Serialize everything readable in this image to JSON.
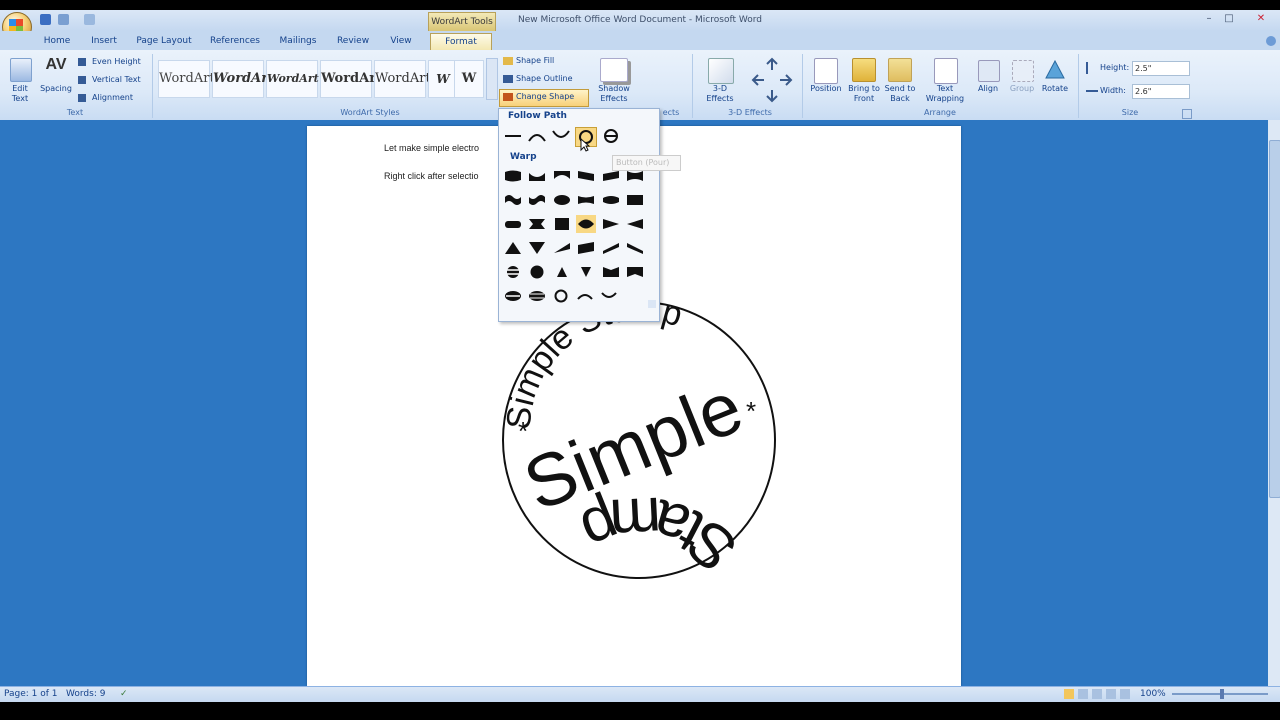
{
  "window": {
    "context_tab": "WordArt Tools",
    "title": "New Microsoft Office Word Document - Microsoft Word",
    "min_icon": "–",
    "max_icon": "□",
    "close_icon": "✕"
  },
  "tabs": [
    {
      "label": "Home"
    },
    {
      "label": "Insert"
    },
    {
      "label": "Page Layout"
    },
    {
      "label": "References"
    },
    {
      "label": "Mailings"
    },
    {
      "label": "Review"
    },
    {
      "label": "View"
    },
    {
      "label": "Format"
    }
  ],
  "ribbon": {
    "text_group": {
      "label": "Text",
      "edit_text": "Edit\nText",
      "spacing": "Spacing",
      "even_height": "Even Height",
      "vertical_text": "Vertical Text",
      "alignment": "Alignment"
    },
    "wordart_styles": {
      "label": "WordArt Styles",
      "samples": [
        "WordArt",
        "WordArt",
        "WordArt",
        "WordArt",
        "WordArt"
      ],
      "vertical_sample": "W",
      "shape_fill": "Shape Fill",
      "shape_outline": "Shape Outline",
      "change_shape": "Change Shape"
    },
    "shadow": {
      "label": "Shadow Effects",
      "button": "Shadow\nEffects",
      "fragment": "ects"
    },
    "three_d": {
      "label": "3-D Effects",
      "button": "3-D\nEffects"
    },
    "arrange": {
      "label": "Arrange",
      "position": "Position",
      "bring_to_front": "Bring to\nFront",
      "send_to_back": "Send to\nBack",
      "text_wrapping": "Text\nWrapping",
      "align": "Align",
      "group": "Group",
      "rotate": "Rotate"
    },
    "size": {
      "label": "Size",
      "height_label": "Height:",
      "height_value": "2.5\"",
      "width_label": "Width:",
      "width_value": "2.6\""
    }
  },
  "gallery": {
    "follow_path_header": "Follow Path",
    "warp_header": "Warp",
    "tooltip": "Button (Pour)"
  },
  "document": {
    "line1": "Let make simple electro",
    "line2": "Right click after selectio",
    "stamp_outer": "Simple Stamp",
    "stamp_inner": "Simple",
    "stamp_bottom": "Stamp",
    "star": "*"
  },
  "status": {
    "page": "Page: 1 of 1",
    "words": "Words: 9",
    "zoom": "100%"
  },
  "colors": {
    "ribbon_text": "#15428b",
    "workspace": "#2d77c2",
    "format_tab": "#f3e8b3"
  }
}
